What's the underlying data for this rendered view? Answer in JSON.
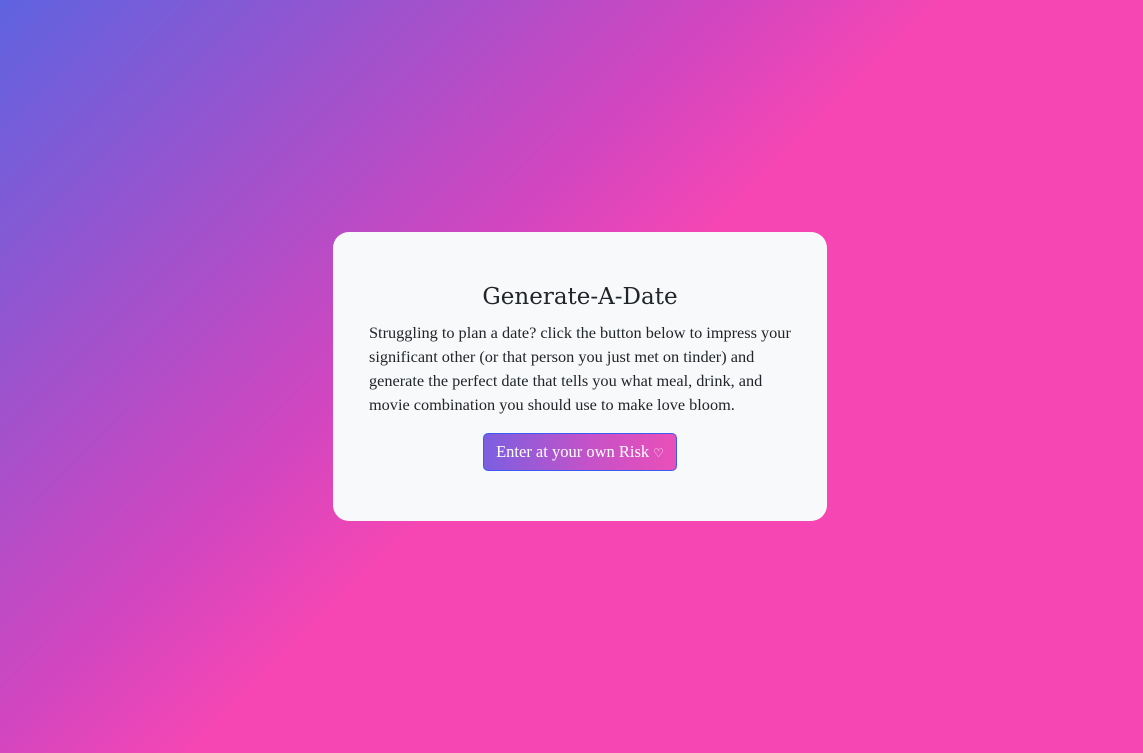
{
  "page": {
    "title": "Generate-A-Date",
    "description": "Struggling to plan a date? click the button below to impress your significant other (or that person you just met on tinder) and generate the perfect date that tells you what meal, drink, and movie combination you should use to make love bloom.",
    "button": {
      "label": "Enter at your own Risk",
      "icon": "heart-icon",
      "icon_glyph": "♡"
    }
  },
  "colors": {
    "background_start": "#5f63e0",
    "background_end": "#f646b4",
    "card": "#f8f9fa",
    "button_border": "#3d5af1"
  }
}
